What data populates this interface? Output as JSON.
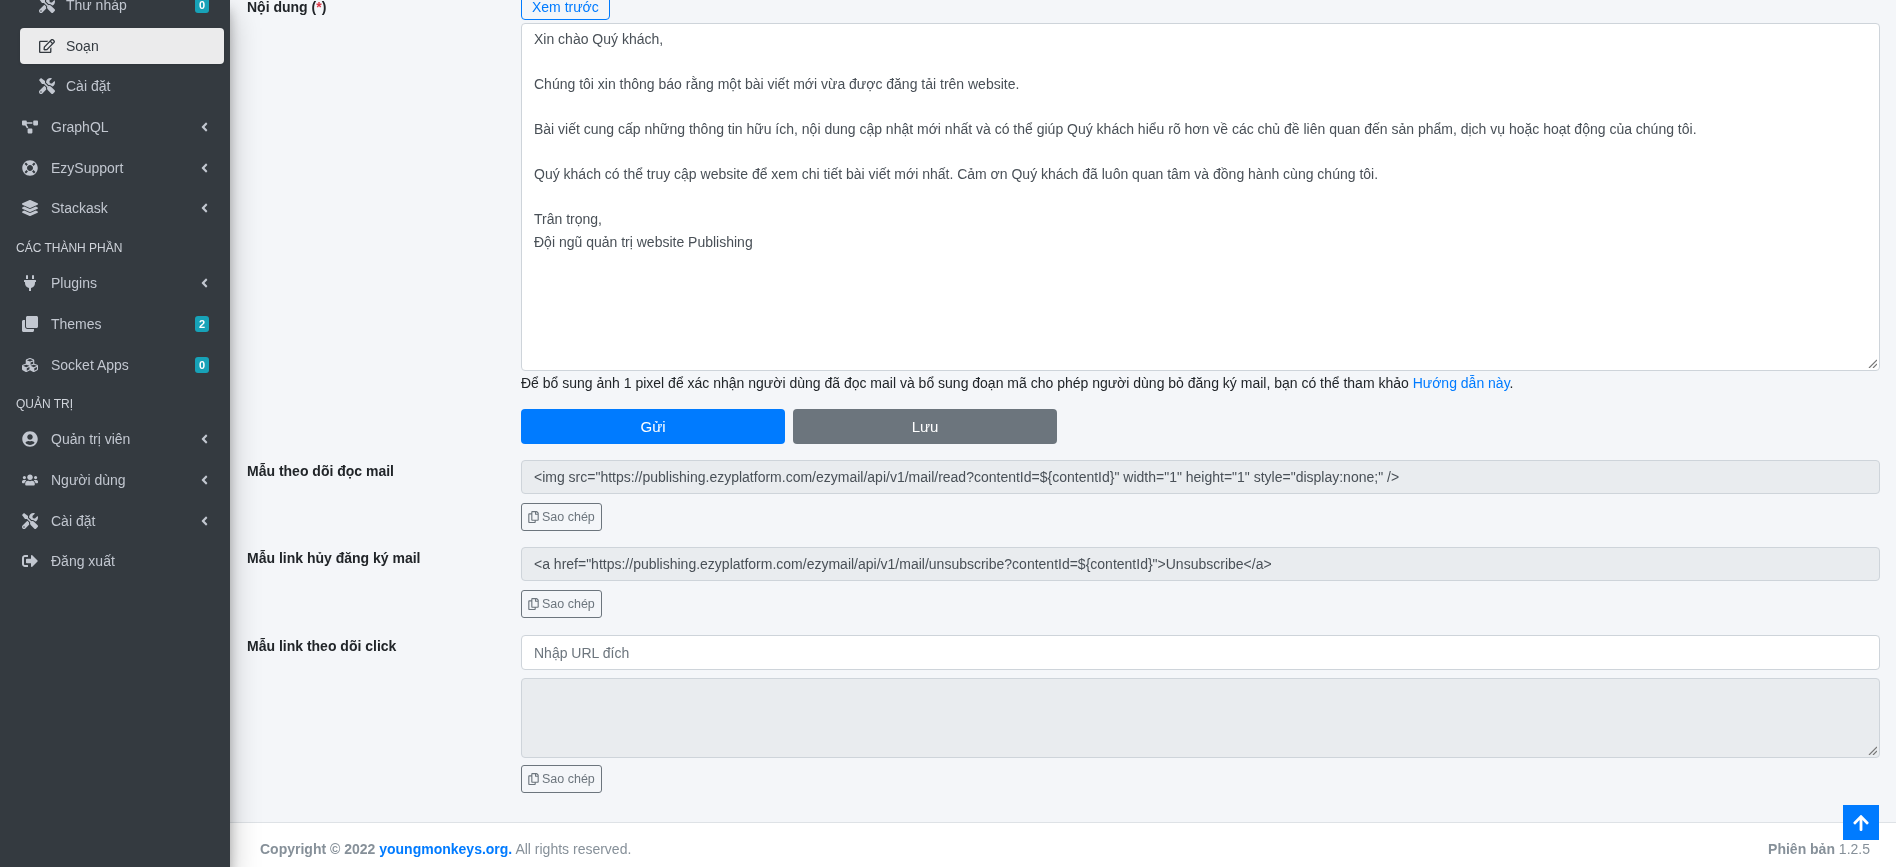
{
  "sidebar": {
    "entries": [
      {
        "kind": "subitem",
        "label": "Thư nháp",
        "badge": "0",
        "selected": false
      },
      {
        "kind": "subitem",
        "label": "Soạn",
        "selected": true
      },
      {
        "kind": "subitem",
        "label": "Cài đặt",
        "selected": false
      },
      {
        "kind": "item",
        "label": "GraphQL",
        "expanded": false,
        "selected": false
      },
      {
        "kind": "item",
        "label": "EzySupport",
        "expanded": false,
        "selected": false
      },
      {
        "kind": "item",
        "label": "Stackask",
        "expanded": false,
        "selected": false
      },
      {
        "kind": "header",
        "label": "CÁC THÀNH PHẦN"
      },
      {
        "kind": "item",
        "label": "Plugins",
        "expanded": false,
        "selected": false
      },
      {
        "kind": "item",
        "label": "Themes",
        "badge": "2",
        "selected": false
      },
      {
        "kind": "item",
        "label": "Socket Apps",
        "badge": "0",
        "selected": false
      },
      {
        "kind": "header",
        "label": "QUẢN TRỊ"
      },
      {
        "kind": "item",
        "label": "Quản trị viên",
        "expanded": false,
        "selected": false
      },
      {
        "kind": "item",
        "label": "Người dùng",
        "expanded": false,
        "selected": false
      },
      {
        "kind": "item",
        "label": "Cài đặt",
        "expanded": false,
        "selected": false
      },
      {
        "kind": "item",
        "label": "Đăng xuất",
        "selected": false
      }
    ]
  },
  "form": {
    "content": {
      "label": "Nội dung",
      "required_mark": {
        "before": "(",
        "mark": "*",
        "after": ")"
      },
      "preview_button": "Xem trước",
      "value": "Xin chào Quý khách,\n\nChúng tôi xin thông báo rằng một bài viết mới vừa được đăng tải trên website.\n\nBài viết cung cấp những thông tin hữu ích, nội dung cập nhật mới nhất và có thể giúp Quý khách hiểu rõ hơn về các chủ đề liên quan đến sản phẩm, dịch vụ hoặc hoạt động của chúng tôi.\n\nQuý khách có thể truy cập website để xem chi tiết bài viết mới nhất. Cảm ơn Quý khách đã luôn quan tâm và đồng hành cùng chúng tôi.\n\nTrân trọng,\nĐội ngũ quản trị website Publishing",
      "hint": {
        "text": "Để bổ sung ảnh 1 pixel để xác nhận người dùng đã đọc mail và bổ sung đoạn mã cho phép người dùng bỏ đăng ký mail, bạn có thể tham khảo",
        "link": "Hướng dẫn này",
        "suffix": "."
      }
    },
    "actions": [
      {
        "label": "Gửi",
        "kind": "primary"
      },
      {
        "label": "Lưu",
        "kind": "secondary"
      }
    ],
    "templates": [
      {
        "kind": "code",
        "label": "Mẫu theo dõi đọc mail",
        "value": "<img src=\"https://publishing.ezyplatform.com/ezymail/api/v1/mail/read?contentId=${contentId}\" width=\"1\" height=\"1\" style=\"display:none;\" />",
        "copy_button": "Sao chép"
      },
      {
        "kind": "code",
        "label": "Mẫu link hủy đăng ký mail",
        "value": "<a href=\"https://publishing.ezyplatform.com/ezymail/api/v1/mail/unsubscribe?contentId=${contentId}\">Unsubscribe</a>",
        "copy_button": "Sao chép"
      },
      {
        "kind": "click",
        "label": "Mẫu link theo dõi click",
        "placeholder": "Nhập URL đích",
        "copy_button": "Sao chép"
      }
    ]
  },
  "footer": {
    "copyright_prefix": "Copyright © 2022",
    "link": "youngmonkeys.org.",
    "copyright_suffix": "All rights reserved.",
    "version_label": "Phiên bản",
    "version": "1.2.5"
  }
}
